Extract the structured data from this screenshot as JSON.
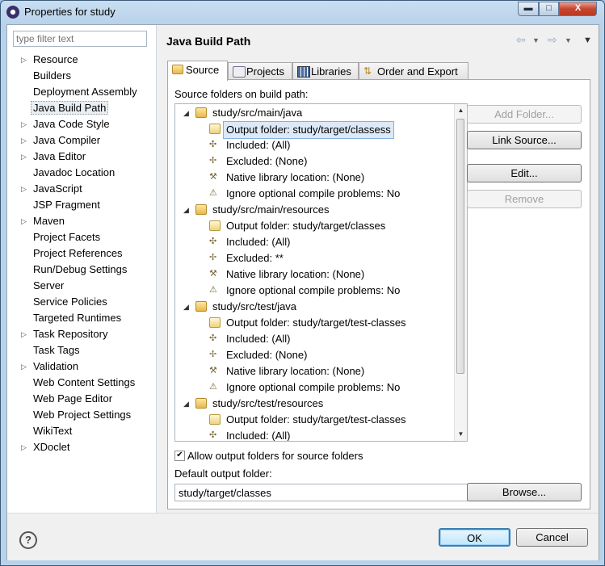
{
  "window": {
    "title": "Properties for study",
    "min": "▬",
    "max": "□",
    "close": "X"
  },
  "filter": {
    "placeholder": "type filter text"
  },
  "nav": [
    {
      "label": "Resource",
      "exp": true
    },
    {
      "label": "Builders",
      "exp": false
    },
    {
      "label": "Deployment Assembly",
      "exp": false
    },
    {
      "label": "Java Build Path",
      "exp": false,
      "selected": true
    },
    {
      "label": "Java Code Style",
      "exp": true
    },
    {
      "label": "Java Compiler",
      "exp": true
    },
    {
      "label": "Java Editor",
      "exp": true
    },
    {
      "label": "Javadoc Location",
      "exp": false
    },
    {
      "label": "JavaScript",
      "exp": true
    },
    {
      "label": "JSP Fragment",
      "exp": false
    },
    {
      "label": "Maven",
      "exp": true
    },
    {
      "label": "Project Facets",
      "exp": false
    },
    {
      "label": "Project References",
      "exp": false
    },
    {
      "label": "Run/Debug Settings",
      "exp": false
    },
    {
      "label": "Server",
      "exp": false
    },
    {
      "label": "Service Policies",
      "exp": false
    },
    {
      "label": "Targeted Runtimes",
      "exp": false
    },
    {
      "label": "Task Repository",
      "exp": true
    },
    {
      "label": "Task Tags",
      "exp": false
    },
    {
      "label": "Validation",
      "exp": true
    },
    {
      "label": "Web Content Settings",
      "exp": false
    },
    {
      "label": "Web Page Editor",
      "exp": false
    },
    {
      "label": "Web Project Settings",
      "exp": false
    },
    {
      "label": "WikiText",
      "exp": false
    },
    {
      "label": "XDoclet",
      "exp": true
    }
  ],
  "page": {
    "title": "Java Build Path"
  },
  "tabs": [
    {
      "label": "Source",
      "active": true
    },
    {
      "label": "Projects"
    },
    {
      "label": "Libraries"
    },
    {
      "label": "Order and Export"
    }
  ],
  "source": {
    "folders_label": "Source folders on build path:",
    "tree": [
      {
        "level": 0,
        "text": "study/src/main/java",
        "icon": "folder"
      },
      {
        "level": 1,
        "text": "Output folder: study/target/classess",
        "icon": "output",
        "selected": true
      },
      {
        "level": 1,
        "text": "Included: (All)",
        "icon": "included"
      },
      {
        "level": 1,
        "text": "Excluded: (None)",
        "icon": "excluded"
      },
      {
        "level": 1,
        "text": "Native library location: (None)",
        "icon": "native"
      },
      {
        "level": 1,
        "text": "Ignore optional compile problems: No",
        "icon": "ignore"
      },
      {
        "level": 0,
        "text": "study/src/main/resources",
        "icon": "folder"
      },
      {
        "level": 1,
        "text": "Output folder: study/target/classes",
        "icon": "output"
      },
      {
        "level": 1,
        "text": "Included: (All)",
        "icon": "included"
      },
      {
        "level": 1,
        "text": "Excluded: **",
        "icon": "excluded"
      },
      {
        "level": 1,
        "text": "Native library location: (None)",
        "icon": "native"
      },
      {
        "level": 1,
        "text": "Ignore optional compile problems: No",
        "icon": "ignore"
      },
      {
        "level": 0,
        "text": "study/src/test/java",
        "icon": "folder"
      },
      {
        "level": 1,
        "text": "Output folder: study/target/test-classes",
        "icon": "output"
      },
      {
        "level": 1,
        "text": "Included: (All)",
        "icon": "included"
      },
      {
        "level": 1,
        "text": "Excluded: (None)",
        "icon": "excluded"
      },
      {
        "level": 1,
        "text": "Native library location: (None)",
        "icon": "native"
      },
      {
        "level": 1,
        "text": "Ignore optional compile problems: No",
        "icon": "ignore"
      },
      {
        "level": 0,
        "text": "study/src/test/resources",
        "icon": "folder"
      },
      {
        "level": 1,
        "text": "Output folder: study/target/test-classes",
        "icon": "output"
      },
      {
        "level": 1,
        "text": "Included: (All)",
        "icon": "included"
      }
    ],
    "buttons": {
      "add_folder": "Add Folder...",
      "link_source": "Link Source...",
      "edit": "Edit...",
      "remove": "Remove"
    },
    "allow_output_label": "Allow output folders for source folders",
    "allow_output_checked": "✔",
    "default_output_label": "Default output folder:",
    "default_output_value": "study/target/classes",
    "browse": "Browse..."
  },
  "footer": {
    "help": "?",
    "ok": "OK",
    "cancel": "Cancel"
  }
}
